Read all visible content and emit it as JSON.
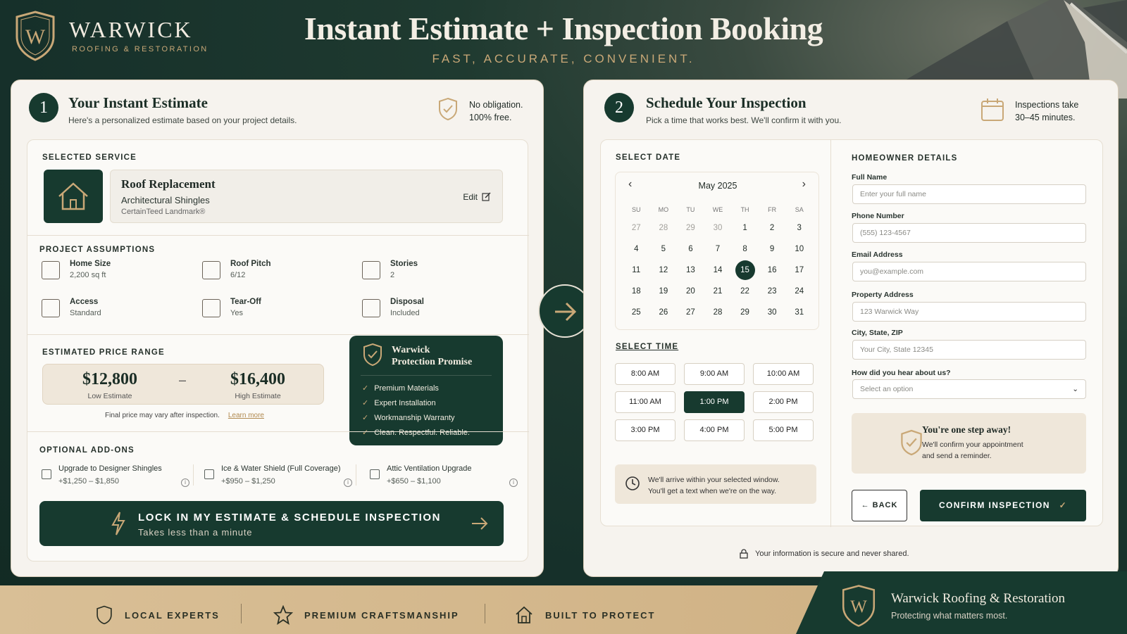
{
  "brand": {
    "name": "WARWICK",
    "tagline": "ROOFING & RESTORATION",
    "logo_letter": "W"
  },
  "hero": {
    "title": "Instant Estimate + Inspection Booking",
    "subtitle": "FAST, ACCURATE, CONVENIENT."
  },
  "estimate": {
    "step": "1",
    "title": "Your Instant Estimate",
    "subtitle": "Here's a personalized estimate based on your project details.",
    "badge_line1": "No obligation.",
    "badge_line2": "100% free.",
    "selected_service_label": "SELECTED SERVICE",
    "service": {
      "name": "Roof Replacement",
      "type": "Architectural Shingles",
      "product": "CertainTeed Landmark®",
      "edit": "Edit"
    },
    "assumptions_label": "PROJECT ASSUMPTIONS",
    "assumptions": [
      {
        "k": "Home Size",
        "v": "2,200 sq ft",
        "icon": "home-icon"
      },
      {
        "k": "Roof Pitch",
        "v": "6/12",
        "icon": "roof-pitch-icon"
      },
      {
        "k": "Stories",
        "v": "2",
        "icon": "building-icon"
      },
      {
        "k": "Access",
        "v": "Standard",
        "icon": "ladder-icon"
      },
      {
        "k": "Tear-Off",
        "v": "Yes",
        "icon": "pry-bar-icon"
      },
      {
        "k": "Disposal",
        "v": "Included",
        "icon": "trash-icon"
      }
    ],
    "price_label": "ESTIMATED PRICE RANGE",
    "low": "$12,800",
    "low_label": "Low Estimate",
    "dash": "–",
    "high": "$16,400",
    "high_label": "High Estimate",
    "price_note": "Final price may vary after inspection.",
    "learn_more": "Learn more",
    "promise": {
      "title_line1": "Warwick",
      "title_line2": "Protection Promise",
      "items": [
        "Premium Materials",
        "Expert Installation",
        "Workmanship Warranty",
        "Clean. Respectful. Reliable."
      ]
    },
    "addons_label": "OPTIONAL ADD-ONS",
    "addons": [
      {
        "title": "Upgrade to Designer Shingles",
        "price": "+$1,250 – $1,850"
      },
      {
        "title": "Ice & Water Shield (Full Coverage)",
        "price": "+$950 – $1,250"
      },
      {
        "title": "Attic Ventilation Upgrade",
        "price": "+$650 – $1,100"
      }
    ],
    "cta": {
      "label": "LOCK IN MY ESTIMATE & SCHEDULE INSPECTION",
      "sub": "Takes less than a minute"
    }
  },
  "schedule": {
    "step": "2",
    "title": "Schedule Your Inspection",
    "subtitle": "Pick a time that works best. We'll confirm it with you.",
    "badge_line1": "Inspections take",
    "badge_line2": "30–45 minutes.",
    "date_label": "SELECT DATE",
    "month": "May 2025",
    "dow": [
      "SU",
      "MO",
      "TU",
      "WE",
      "TH",
      "FR",
      "SA"
    ],
    "days": [
      "27",
      "28",
      "29",
      "30",
      "1",
      "2",
      "3",
      "4",
      "5",
      "6",
      "7",
      "8",
      "9",
      "10",
      "11",
      "12",
      "13",
      "14",
      "15",
      "16",
      "17",
      "18",
      "19",
      "20",
      "21",
      "22",
      "23",
      "24",
      "25",
      "26",
      "27",
      "28",
      "29",
      "30",
      "31"
    ],
    "selected_day": "15",
    "time_label": "SELECT TIME",
    "times": [
      "8:00 AM",
      "9:00 AM",
      "10:00 AM",
      "11:00 AM",
      "1:00 PM",
      "2:00 PM",
      "3:00 PM",
      "4:00 PM",
      "5:00 PM"
    ],
    "selected_time": "1:00 PM",
    "arrive_line1": "We'll arrive within your selected window.",
    "arrive_line2": "You'll get a text when we're on the way.",
    "details_label": "HOMEOWNER DETAILS",
    "fields": [
      {
        "label": "Full Name",
        "placeholder": "Enter your full name"
      },
      {
        "label": "Phone Number",
        "placeholder": "(555) 123-4567"
      },
      {
        "label": "Email Address",
        "placeholder": "you@example.com"
      },
      {
        "label": "Property Address",
        "placeholder": "123 Warwick Way"
      },
      {
        "label": "City, State, ZIP",
        "placeholder": "Your City, State 12345"
      }
    ],
    "hear_label": "How did you hear about us?",
    "hear_value": "Select an option",
    "step_away_title": "You're one step away!",
    "step_away_line1": "We'll confirm your appointment",
    "step_away_line2": "and send a reminder.",
    "back": "BACK",
    "confirm": "CONFIRM INSPECTION",
    "secure": "Your information is secure and never shared."
  },
  "footer": {
    "trust": [
      "LOCAL EXPERTS",
      "PREMIUM CRAFTSMANSHIP",
      "BUILT TO PROTECT"
    ],
    "company": "Warwick Roofing & Restoration",
    "company_tagline": "Protecting what matters most."
  },
  "colors": {
    "primary": "#173a2f",
    "gold": "#c9a877",
    "panel": "#f6f3ee",
    "band": "#d6b98e"
  }
}
